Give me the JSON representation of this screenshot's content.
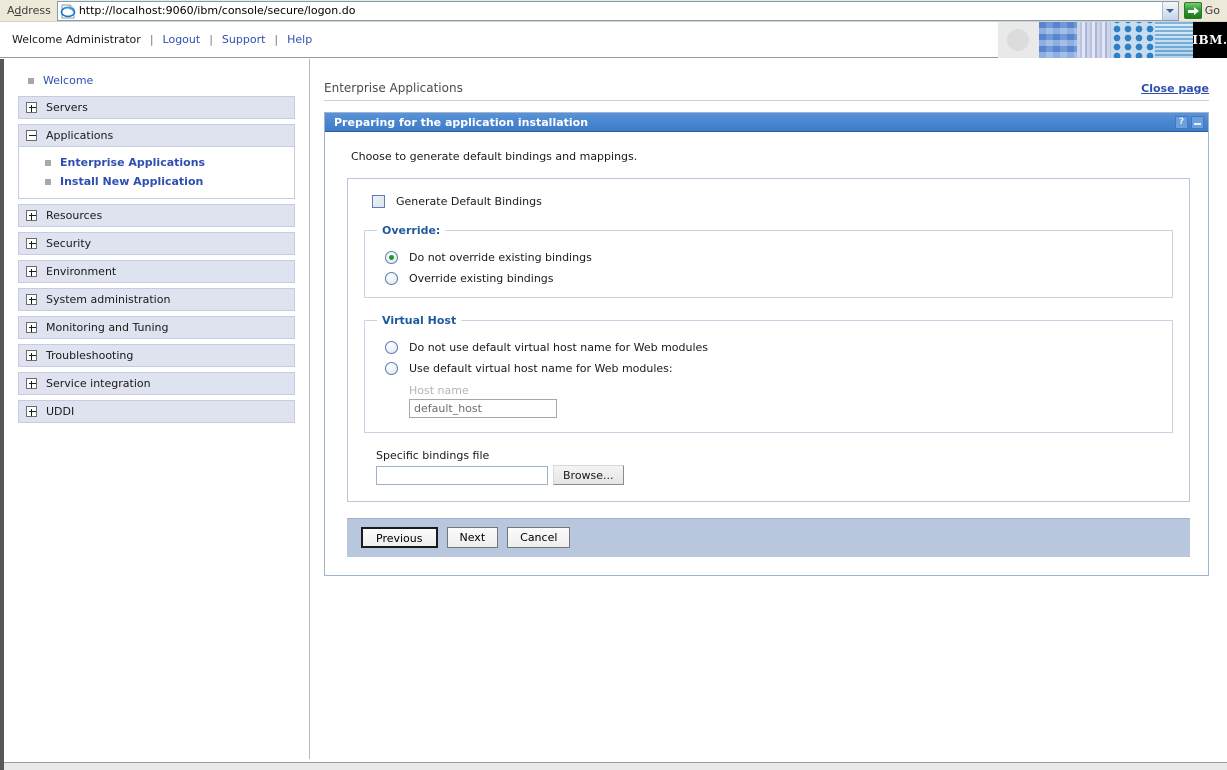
{
  "browser": {
    "address_label": "Address",
    "address_label_accel": "d",
    "url": "http://localhost:9060/ibm/console/secure/logon.do",
    "go_label": "Go",
    "icons": {
      "page": "ie-page-icon",
      "dropdown": "chevron-down-icon",
      "go": "green-arrow-go-icon"
    }
  },
  "header": {
    "welcome": "Welcome Administrator",
    "separator": "|",
    "links": [
      {
        "label": "Logout"
      },
      {
        "label": "Support"
      },
      {
        "label": "Help"
      }
    ],
    "brand": "IBM.",
    "banner_tiles": [
      "grey-circle",
      "blue-checkerboard",
      "vertical-stripes",
      "blue-dot-grid",
      "water-ripple",
      "ibm-logo"
    ]
  },
  "sidebar": {
    "welcome": {
      "label": "Welcome",
      "icon": "leaf-square-icon"
    },
    "groups": [
      {
        "label": "Servers",
        "expanded": false,
        "icon": "expand-plus-icon",
        "children": []
      },
      {
        "label": "Applications",
        "expanded": true,
        "icon": "collapse-minus-icon",
        "children": [
          {
            "label": "Enterprise Applications",
            "icon": "leaf-square-icon"
          },
          {
            "label": "Install New Application",
            "icon": "leaf-square-icon"
          }
        ]
      },
      {
        "label": "Resources",
        "expanded": false,
        "icon": "expand-plus-icon",
        "children": []
      },
      {
        "label": "Security",
        "expanded": false,
        "icon": "expand-plus-icon",
        "children": []
      },
      {
        "label": "Environment",
        "expanded": false,
        "icon": "expand-plus-icon",
        "children": []
      },
      {
        "label": "System administration",
        "expanded": false,
        "icon": "expand-plus-icon",
        "children": []
      },
      {
        "label": "Monitoring and Tuning",
        "expanded": false,
        "icon": "expand-plus-icon",
        "children": []
      },
      {
        "label": "Troubleshooting",
        "expanded": false,
        "icon": "expand-plus-icon",
        "children": []
      },
      {
        "label": "Service integration",
        "expanded": false,
        "icon": "expand-plus-icon",
        "children": []
      },
      {
        "label": "UDDI",
        "expanded": false,
        "icon": "expand-plus-icon",
        "children": []
      }
    ]
  },
  "content": {
    "breadcrumb": "Enterprise Applications",
    "close_page": "Close page",
    "panel": {
      "title": "Preparing for the application installation",
      "help_icon_label": "?",
      "minimize_icon": "minimize-icon"
    },
    "intro": "Choose to generate default bindings and mappings.",
    "generate_bindings": {
      "label": "Generate Default Bindings",
      "checked": false
    },
    "override_group": {
      "legend": "Override:",
      "options": [
        {
          "label": "Do not override existing bindings",
          "selected": true
        },
        {
          "label": "Override existing bindings",
          "selected": false
        }
      ]
    },
    "virtual_host_group": {
      "legend": "Virtual Host",
      "options": [
        {
          "label": "Do not use default virtual host name for Web modules",
          "selected": false
        },
        {
          "label": "Use default virtual host name for Web modules:",
          "selected": false
        }
      ],
      "host_name_label": "Host name",
      "host_name_value": "default_host",
      "host_name_disabled": true
    },
    "specific_bindings": {
      "label": "Specific bindings file",
      "value": "",
      "placeholder": "",
      "browse_label": "Browse..."
    },
    "buttons": [
      {
        "label": "Previous",
        "default": true
      },
      {
        "label": "Next",
        "default": false
      },
      {
        "label": "Cancel",
        "default": false
      }
    ]
  },
  "colors": {
    "accent_blue": "#4a86d0",
    "link_blue": "#2f4fb0",
    "legend_blue": "#1f5a9e",
    "button_bar": "#b9c7de",
    "nav_header": "#dfe3f0",
    "radio_selected": "#1f9a1f"
  }
}
